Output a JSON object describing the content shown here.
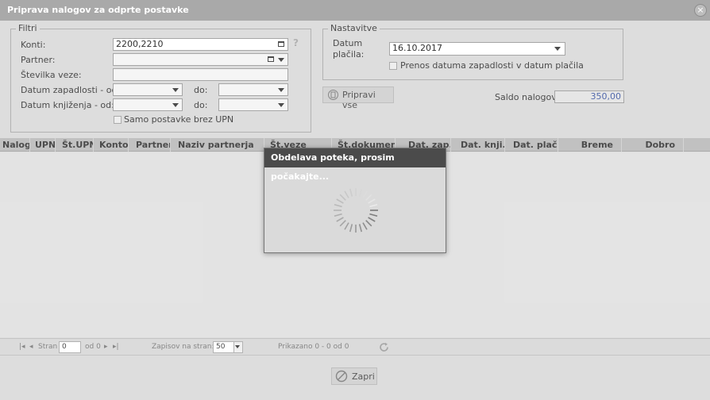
{
  "window": {
    "title": "Priprava nalogov za odprte postavke",
    "close_symbol": "×"
  },
  "filters": {
    "legend": "Filtri",
    "konti_label": "Konti:",
    "konti_value": "2200,2210",
    "help_symbol": "?",
    "partner_label": "Partner:",
    "partner_value": "",
    "stevilka_veze_label": "Številka veze:",
    "stevilka_veze_value": "",
    "datum_zapadlosti_label": "Datum zapadlosti - od:",
    "datum_zapadlosti_od": "",
    "do_label_1": "do:",
    "datum_zapadlosti_do": "",
    "datum_knjizenja_label": "Datum knjiženja - od:",
    "datum_knjizenja_od": "",
    "do_label_2": "do:",
    "datum_knjizenja_do": "",
    "samo_postavke_label": "Samo postavke brez UPN",
    "samo_postavke_checked": false
  },
  "settings": {
    "legend": "Nastavitve",
    "datum_placila_label_1": "Datum",
    "datum_placila_label_2": "plačila:",
    "datum_placila_value": "16.10.2017",
    "prenos_label": "Prenos datuma zapadlosti v datum plačila",
    "prenos_checked": false
  },
  "actions": {
    "pripravi_vse_label": "Pripravi vse",
    "saldo_label": "Saldo nalogov:",
    "saldo_value": "350,00"
  },
  "grid": {
    "columns": [
      "Nalog",
      "UPN",
      "Št.UPN",
      "Konto",
      "Partner",
      "Naziv partnerja",
      "Št.veze",
      "Št.dokumenta",
      "Dat. zap.",
      "Dat. knji.",
      "Dat. plač.",
      "Breme",
      "Dobro"
    ]
  },
  "pager": {
    "stran_label": "Stran",
    "page_value": "0",
    "od_label": "od 0",
    "zapisov_label": "Zapisov na stran:",
    "per_page_value": "50",
    "prikazano": "Prikazano 0 - 0 od 0"
  },
  "footer": {
    "zapri_label": "Zapri"
  },
  "loading": {
    "message": "Obdelava poteka, prosim počakajte..."
  },
  "colors": {
    "titlebar": "#a9a9a9",
    "loading_title": "#4b4b4b",
    "saldo_text": "#3b55a0",
    "grid_header": "#b9b9b9"
  }
}
